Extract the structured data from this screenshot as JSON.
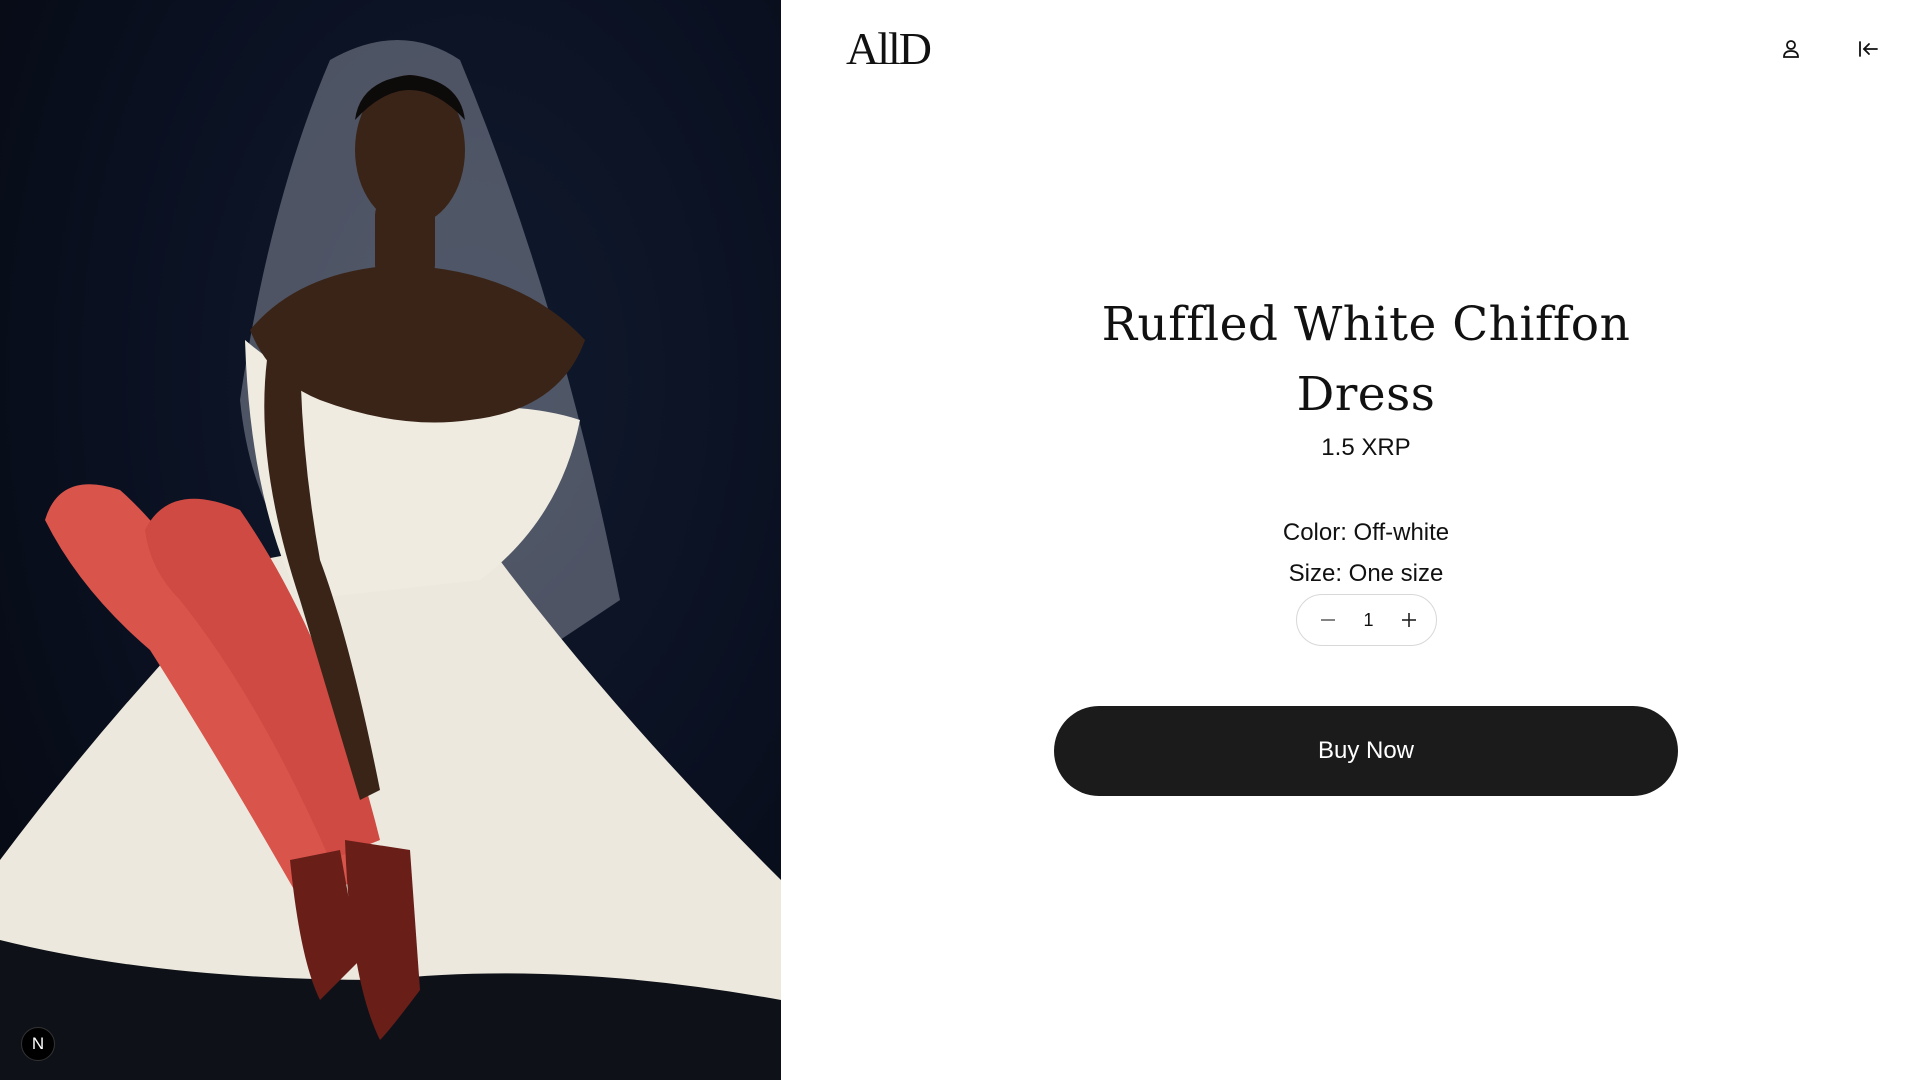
{
  "brand": {
    "logo_text": "AllD"
  },
  "header": {
    "icons": [
      "user-icon",
      "arrow-left-to-line-icon"
    ]
  },
  "product": {
    "title": "Ruffled White Chiffon Dress",
    "price": "1.5 XRP",
    "color_label": "Color: Off-white",
    "size_label": "Size: One size",
    "quantity": "1",
    "buy_label": "Buy Now"
  },
  "badge": {
    "text": "N"
  },
  "colors": {
    "background": "#ffffff",
    "button_bg": "#1b1b1b",
    "button_text": "#ffffff",
    "photo_bg": "#0a1020",
    "tights": "#d9544b"
  }
}
